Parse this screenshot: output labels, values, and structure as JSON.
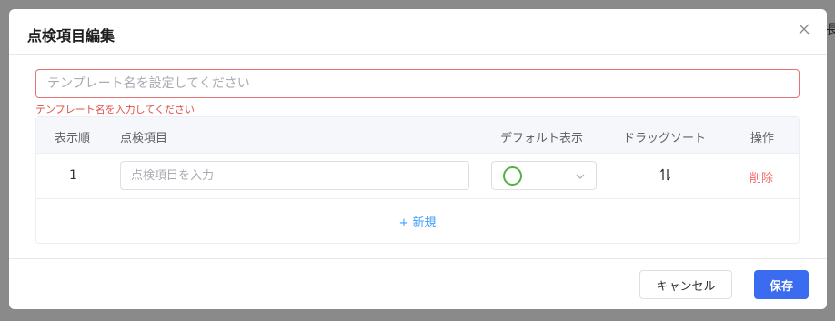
{
  "background": {
    "peek_text": "長"
  },
  "dialog": {
    "title": "点検項目編集",
    "close_icon": "close-icon",
    "template_name": {
      "value": "",
      "placeholder": "テンプレート名を設定してください",
      "error": "テンプレート名を入力してください"
    },
    "table": {
      "headers": {
        "order": "表示順",
        "item": "点検項目",
        "default_display": "デフォルト表示",
        "drag_sort": "ドラッグソート",
        "action": "操作"
      },
      "rows": [
        {
          "order": "1",
          "item_value": "",
          "item_placeholder": "点検項目を入力",
          "default_icon": "green-circle-icon",
          "drag_icon": "drag-sort-icon",
          "delete_label": "削除"
        }
      ],
      "add_label": "+ 新規"
    },
    "footer": {
      "cancel_label": "キャンセル",
      "save_label": "保存"
    }
  },
  "colors": {
    "primary": "#3b6cf0",
    "error": "#e0504a",
    "link": "#409eff",
    "delete": "#f56c6c",
    "circle": "#52b043"
  }
}
